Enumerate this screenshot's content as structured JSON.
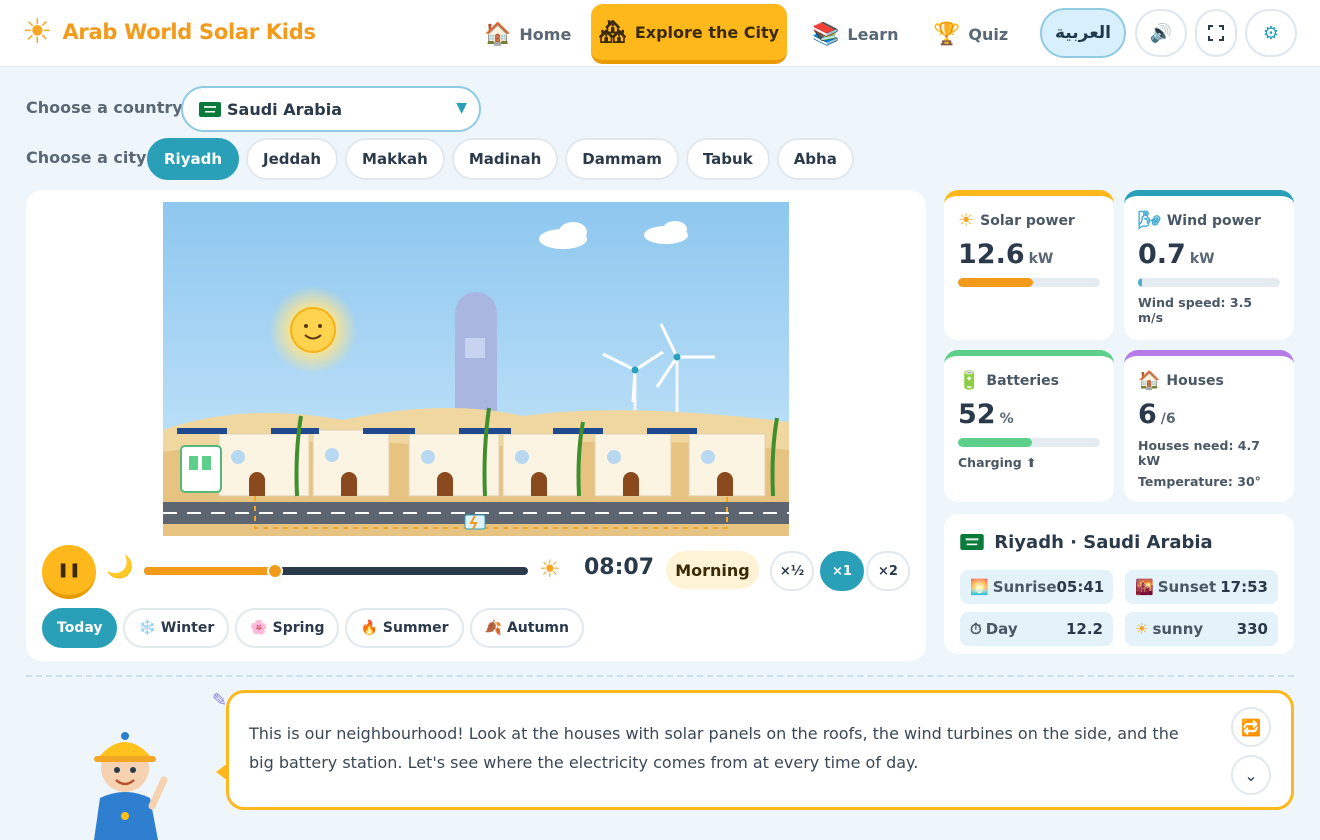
{
  "app": {
    "title": "Arab World Solar Kids"
  },
  "nav": {
    "home": "Home",
    "explore": "Explore the City",
    "learn": "Learn",
    "quiz": "Quiz",
    "language": "العربية"
  },
  "selectors": {
    "country_label": "Choose a country",
    "country_value": "Saudi Arabia",
    "city_label": "Choose a city",
    "cities": [
      "Riyadh",
      "Jeddah",
      "Makkah",
      "Madinah",
      "Dammam",
      "Tabuk",
      "Abha"
    ],
    "active_city": "Riyadh"
  },
  "controls": {
    "time": "08:07",
    "phase": "Morning",
    "time_progress": 0.34,
    "speeds": [
      "×½",
      "×1",
      "×2"
    ],
    "active_speed": "×1",
    "seasons": [
      {
        "label": "Today",
        "icon": ""
      },
      {
        "label": "Winter",
        "icon": "❄️"
      },
      {
        "label": "Spring",
        "icon": "🌸"
      },
      {
        "label": "Summer",
        "icon": "🔥"
      },
      {
        "label": "Autumn",
        "icon": "🍂"
      }
    ]
  },
  "stats": {
    "solar": {
      "label": "Solar power",
      "value": "12.6",
      "unit": "kW",
      "level": 0.53,
      "color": "#f29a1a"
    },
    "wind": {
      "label": "Wind power",
      "value": "0.7",
      "unit": "kW",
      "level": 0.03,
      "note": "Wind speed: 3.5 m/s",
      "color": "#4aaed4"
    },
    "batteries": {
      "label": "Batteries",
      "value": "52",
      "unit": "%",
      "level": 0.52,
      "note": "Charging ⬆",
      "color": "#5ccf8a"
    },
    "houses": {
      "label": "Houses",
      "value": "6",
      "unit": "/6",
      "note1": "Houses need: 4.7 kW",
      "note2": "Temperature: 30°"
    }
  },
  "info": {
    "title": "Riyadh · Saudi Arabia",
    "sunrise_label": "Sunrise",
    "sunrise": "05:41",
    "sunset_label": "Sunset",
    "sunset": "17:53",
    "day_label": "Day",
    "day": "12.2",
    "weather_label": "sunny",
    "weather": "330"
  },
  "guide": {
    "text": "This is our neighbourhood! Look at the houses with solar panels on the roofs, the wind turbines on the side, and the big battery station. Let's see where the electricity comes from at every time of day."
  }
}
